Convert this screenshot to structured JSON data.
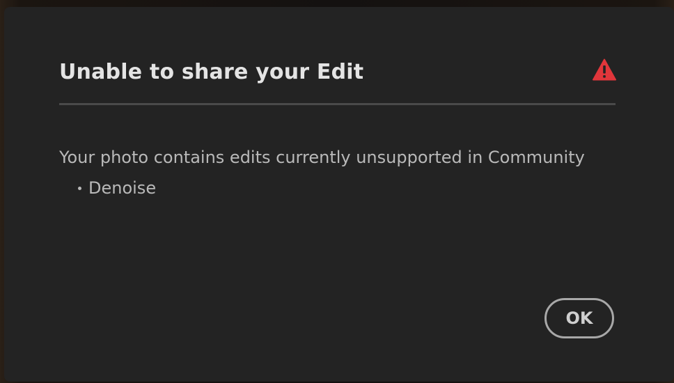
{
  "dialog": {
    "title": "Unable to share your Edit",
    "alert_icon": "alert-triangle-icon",
    "alert_color": "#e0363b",
    "message": "Your photo contains edits currently unsupported in Community",
    "unsupported_edits": [
      {
        "label": "Denoise"
      }
    ],
    "ok_label": "OK"
  }
}
